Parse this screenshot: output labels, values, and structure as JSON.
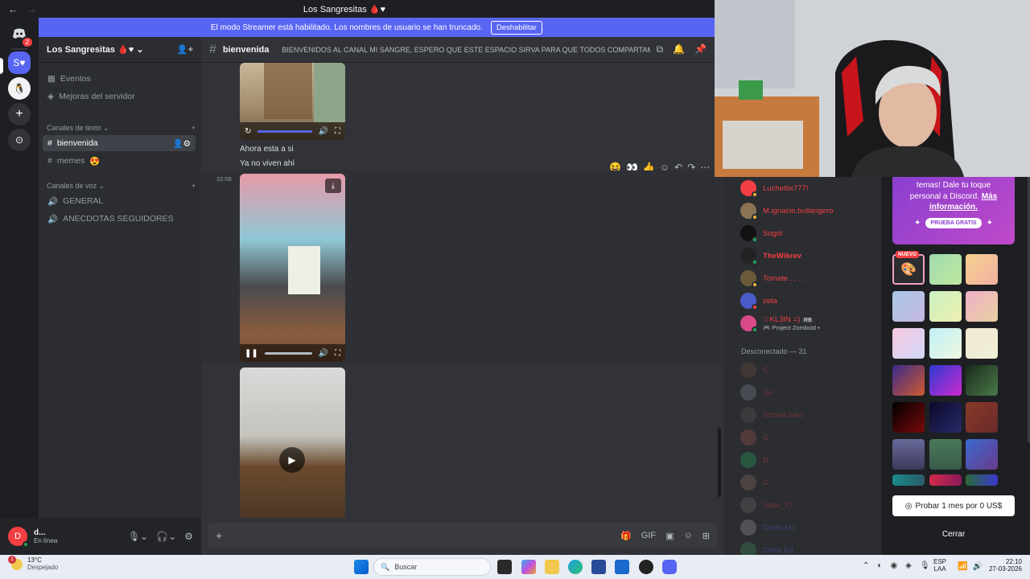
{
  "window": {
    "title": "Los Sangresitas"
  },
  "rail": {
    "dm_badge": "2"
  },
  "banner": {
    "text": "El modo Streamer está habilitado. Los nombres de usuario se han truncado.",
    "button": "Deshabilitar"
  },
  "server": {
    "name": "Los Sangresitas",
    "items": [
      {
        "label": "Eventos"
      },
      {
        "label": "Mejoras del servidor"
      }
    ],
    "text_category": "Canales de texto",
    "text_channels": [
      {
        "label": "bienvenida"
      },
      {
        "label": "memes"
      }
    ],
    "voice_category": "Canales de voz",
    "voice_channels": [
      {
        "label": "GENERAL"
      },
      {
        "label": "ANECDOTAS SEGUIDORES"
      }
    ]
  },
  "user": {
    "name": "d...",
    "status": "En línea"
  },
  "channel": {
    "name": "bienvenida",
    "topic": "BIENVENIDOS AL CANAL MI SANGRE, ESPERO QUE ESTE ESPACIO SIRVA PARA QUE TODOS COMPARTAMOS..."
  },
  "messages": {
    "line1": "Ahora esta a si",
    "line2": "Ya no viven ahí",
    "timestamp": "22:08"
  },
  "members": {
    "online": [
      {
        "name": "Luchettix777!",
        "color": "#f23f43"
      },
      {
        "name": "M.ignacio.bullangero",
        "color": "#f23f43"
      },
      {
        "name": "Sogol",
        "color": "#f23f43"
      },
      {
        "name": "TheWikrev",
        "color": "#f23f43"
      },
      {
        "name": "Tomate . . . .",
        "color": "#f23f43"
      },
      {
        "name": "zeta",
        "color": "#f23f43"
      },
      {
        "name": "☆KL3IN =)",
        "color": "#f23f43",
        "tag": "RB",
        "activity": "Project Zomboid •"
      }
    ],
    "offline_header": "Desconectado — 31",
    "offline": [
      {
        "name": "C"
      },
      {
        "name": "Ge"
      },
      {
        "name": "Schmit toko"
      },
      {
        "name": "G"
      },
      {
        "name": "D"
      },
      {
        "name": "G"
      },
      {
        "name": "Sasa_77"
      },
      {
        "name": "Cristo Mc"
      },
      {
        "name": "Crota Ed"
      }
    ]
  },
  "nitro": {
    "promo_line1": "temas! Dale tu toque",
    "promo_line2": "personal a Discord.",
    "promo_link": "Más información.",
    "free_label": "PRUEBA GRATIS",
    "new_label": "NUEVO",
    "try_button": "Probar 1 mes por 0 US$",
    "close_button": "Cerrar"
  },
  "taskbar": {
    "weather_temp": "13°C",
    "weather_desc": "Despejado",
    "weather_badge": "1",
    "search": "Buscar",
    "lang1": "ESP",
    "lang2": "LAA",
    "time": "22:10",
    "date": "27-03-2026"
  }
}
